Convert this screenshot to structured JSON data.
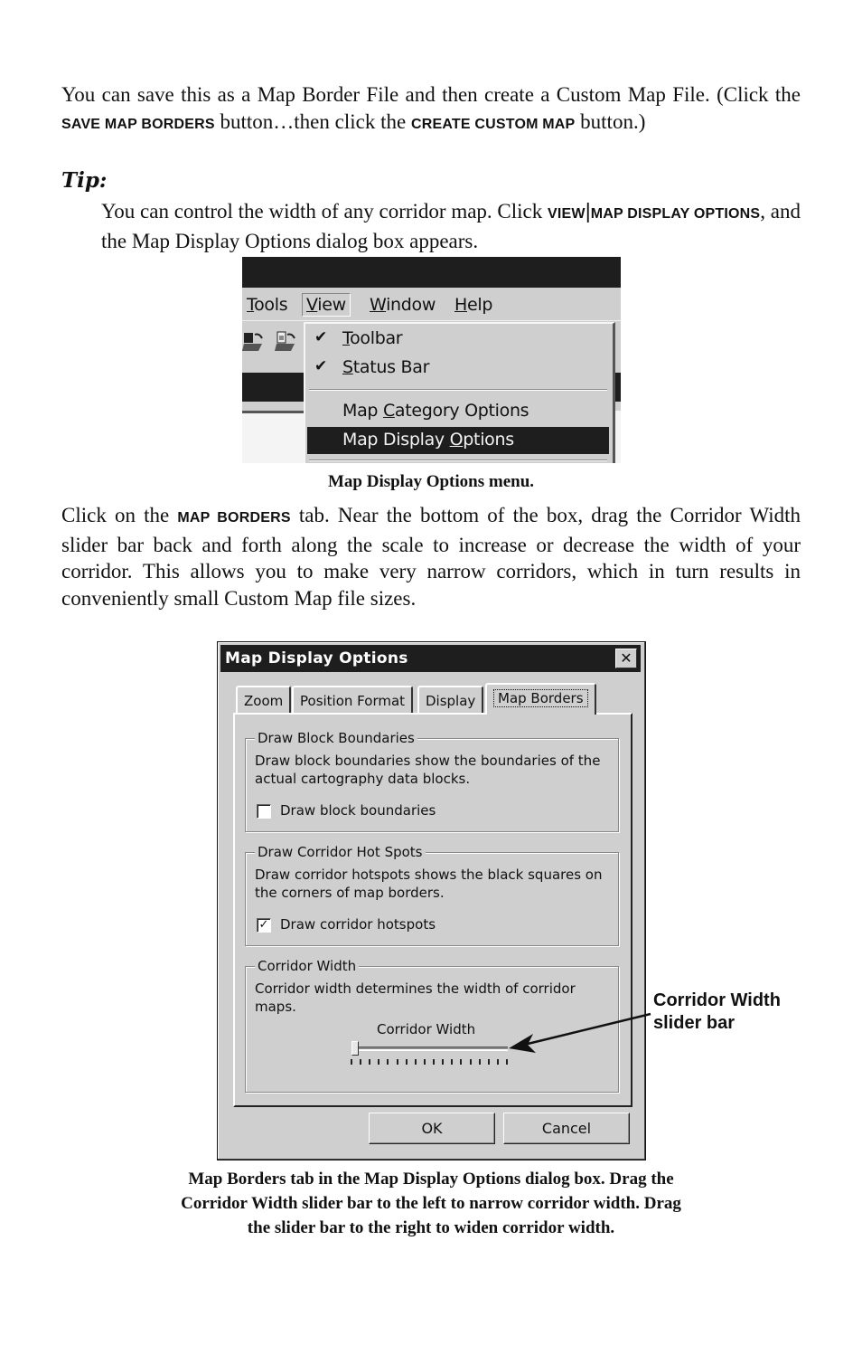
{
  "paragraph1": {
    "p1": "You can save this as a Map Border File and then create a Custom Map File. (Click the ",
    "save_map_borders": "Save Map Borders",
    "p2": " button…then click the ",
    "create_custom_map": "Create Custom Map",
    "p3": " button.)"
  },
  "tip": {
    "label": "Tip:",
    "t1": "You can control the width of any corridor map. Click ",
    "view": "View",
    "sep": "|",
    "map_display_options": "Map Display Options",
    "t2": ", and the Map Display Options dialog box  appears."
  },
  "menu_screenshot": {
    "menubar": {
      "tools": "Tools",
      "tools_u": "T",
      "tools_rest": "ools",
      "view": "View",
      "view_u": "V",
      "view_rest": "iew",
      "window": "Window",
      "window_u": "W",
      "window_rest": "indow",
      "help": "Help",
      "help_u": "H",
      "help_rest": "elp"
    },
    "dropdown": {
      "items": [
        {
          "label": "Toolbar",
          "pre": "",
          "u": "T",
          "post": "oolbar",
          "checked": true,
          "check_glyph": "✔"
        },
        {
          "label": "Status Bar",
          "pre": "",
          "u": "S",
          "post": "tatus Bar",
          "checked": true,
          "check_glyph": "✔"
        },
        {
          "label": "Map Category Options",
          "pre": "Map ",
          "u": "C",
          "post": "ategory Options",
          "checked": false
        },
        {
          "label": "Map Display Options",
          "pre": "Map Display ",
          "u": "O",
          "post": "ptions",
          "checked": false,
          "selected": true
        }
      ]
    },
    "caption": "Map Display Options menu."
  },
  "paragraph2": {
    "p1": "Click on the ",
    "map_borders": "Map Borders",
    "p2": " tab. Near the bottom of the box, drag the Corridor Width slider bar back and forth along the scale to increase or decrease the width of your corridor. This allows you to make very narrow corridors, which in turn results in conveniently small Custom Map file sizes."
  },
  "dialog": {
    "title": "Map Display Options",
    "close_glyph": "✕",
    "tabs": [
      "Zoom",
      "Position Format",
      "Display",
      "Map Borders"
    ],
    "active_tab": "Map Borders",
    "groups": {
      "block": {
        "legend": "Draw Block Boundaries",
        "description": "Draw block boundaries show the boundaries of the actual cartography data blocks.",
        "checkbox_label": "Draw block boundaries",
        "checked": false
      },
      "hotspots": {
        "legend": "Draw Corridor Hot Spots",
        "description": "Draw corridor hotspots shows the black squares on the corners of map borders.",
        "checkbox_label": "Draw corridor hotspots",
        "checked": true,
        "check_glyph": "✓"
      },
      "corridor": {
        "legend": "Corridor Width",
        "description": "Corridor width determines the width of corridor maps.",
        "slider_label": "Corridor Width",
        "slider_value_fraction": 0.0,
        "tick_count": 18
      }
    },
    "ok_label": "OK",
    "cancel_label": "Cancel"
  },
  "annotation": {
    "line1": "Corridor Width",
    "line2": "slider bar"
  },
  "caption2": {
    "line1": "Map Borders tab in the Map Display Options dialog box. Drag the",
    "line2": "Corridor Width slider bar to the left to narrow corridor width. Drag",
    "line3": "the slider bar to the right to widen corridor width."
  }
}
